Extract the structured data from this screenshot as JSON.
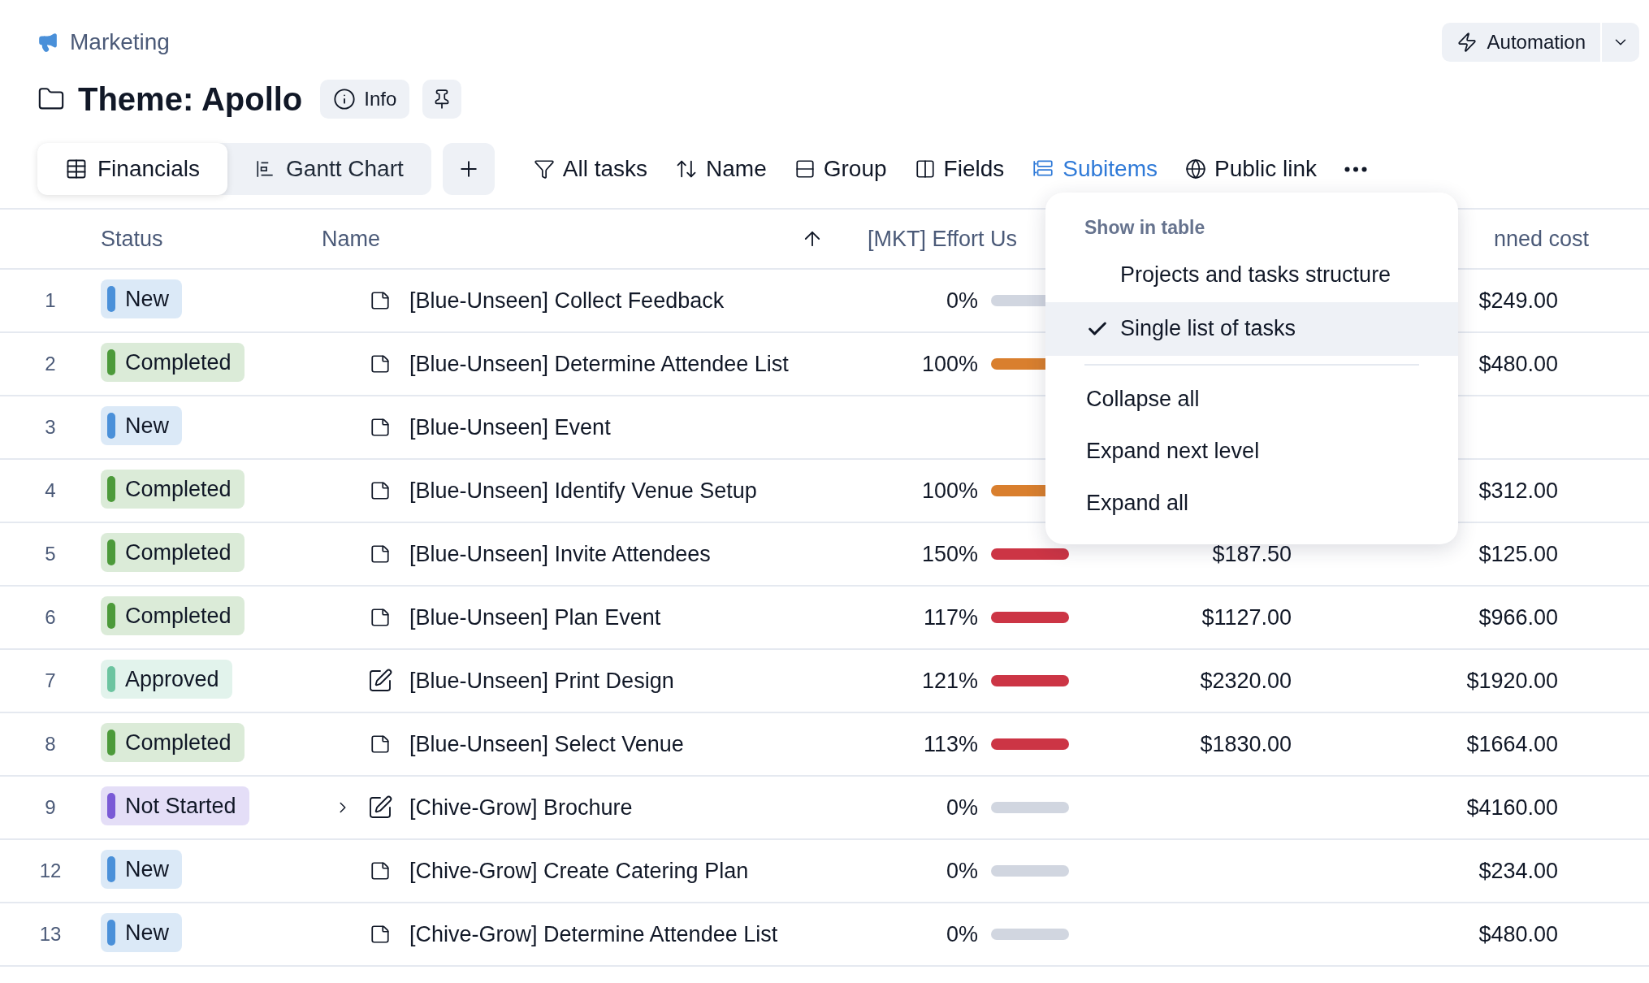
{
  "breadcrumb": "Marketing",
  "title": "Theme: Apollo",
  "info_button": "Info",
  "automation_button": "Automation",
  "views": [
    {
      "label": "Financials",
      "kind": "table",
      "selected": true
    },
    {
      "label": "Gantt Chart",
      "kind": "gantt",
      "selected": false
    }
  ],
  "toolbar": [
    {
      "label": "All tasks",
      "kind": "filter",
      "active": false
    },
    {
      "label": "Name",
      "kind": "sort",
      "active": false
    },
    {
      "label": "Group",
      "kind": "group",
      "active": false
    },
    {
      "label": "Fields",
      "kind": "fields",
      "active": false
    },
    {
      "label": "Subitems",
      "kind": "subitems",
      "active": true
    },
    {
      "label": "Public link",
      "kind": "link",
      "active": false
    }
  ],
  "table": {
    "columns": [
      "Status",
      "Name",
      "[MKT] Effort Us",
      "nned cost"
    ],
    "rows": [
      {
        "number": "1",
        "status": {
          "label": "New",
          "color": "#4a90d9"
        },
        "kind": "task",
        "name": "[Blue-Unseen] Collect Feedback",
        "effort": "0%",
        "bar": {
          "color": "#d1d6e0"
        },
        "column_4": null,
        "cost": "$249.00"
      },
      {
        "number": "2",
        "status": {
          "label": "Completed",
          "color": "#4c9a3a"
        },
        "kind": "task",
        "name": "[Blue-Unseen] Determine Attendee List",
        "effort": "100%",
        "bar": {
          "color": "#d97f2e"
        },
        "column_4": null,
        "cost": "$480.00"
      },
      {
        "number": "3",
        "status": {
          "label": "New",
          "color": "#4a90d9"
        },
        "kind": "task",
        "name": "[Blue-Unseen] Event",
        "effort": null,
        "bar": null,
        "column_4": null,
        "cost": null
      },
      {
        "number": "4",
        "status": {
          "label": "Completed",
          "color": "#4c9a3a"
        },
        "kind": "task",
        "name": "[Blue-Unseen] Identify Venue Setup",
        "effort": "100%",
        "bar": {
          "color": "#d97f2e"
        },
        "column_4": null,
        "cost": "$312.00"
      },
      {
        "number": "5",
        "status": {
          "label": "Completed",
          "color": "#4c9a3a"
        },
        "kind": "task",
        "name": "[Blue-Unseen] Invite Attendees",
        "effort": "150%",
        "bar": {
          "color": "#cc3545"
        },
        "column_4": "$187.50",
        "cost": "$125.00"
      },
      {
        "number": "6",
        "status": {
          "label": "Completed",
          "color": "#4c9a3a"
        },
        "kind": "task",
        "name": "[Blue-Unseen] Plan Event",
        "effort": "117%",
        "bar": {
          "color": "#cc3545"
        },
        "column_4": "$1127.00",
        "cost": "$966.00"
      },
      {
        "number": "7",
        "status": {
          "label": "Approved",
          "color": "#6cc4a0"
        },
        "kind": "design",
        "name": "[Blue-Unseen] Print Design",
        "effort": "121%",
        "bar": {
          "color": "#cc3545"
        },
        "column_4": "$2320.00",
        "cost": "$1920.00"
      },
      {
        "number": "8",
        "status": {
          "label": "Completed",
          "color": "#4c9a3a"
        },
        "kind": "task",
        "name": "[Blue-Unseen] Select Venue",
        "effort": "113%",
        "bar": {
          "color": "#cc3545"
        },
        "column_4": "$1830.00",
        "cost": "$1664.00"
      },
      {
        "number": "9",
        "status": {
          "label": "Not Started",
          "color": "#7a5ad6"
        },
        "kind": "design",
        "expanded": false,
        "name": "[Chive-Grow] Brochure",
        "effort": "0%",
        "bar": {
          "color": "#d1d6e0"
        },
        "column_4": null,
        "cost": "$4160.00"
      },
      {
        "number": "12",
        "status": {
          "label": "New",
          "color": "#4a90d9"
        },
        "kind": "task",
        "name": "[Chive-Grow] Create Catering Plan",
        "effort": "0%",
        "bar": {
          "color": "#d1d6e0"
        },
        "column_4": null,
        "cost": "$234.00"
      },
      {
        "number": "13",
        "status": {
          "label": "New",
          "color": "#4a90d9"
        },
        "kind": "task",
        "name": "[Chive-Grow] Determine Attendee List",
        "effort": "0%",
        "bar": {
          "color": "#d1d6e0"
        },
        "column_4": null,
        "cost": "$480.00"
      }
    ]
  },
  "subitems_menu": {
    "heading": "Show in table",
    "items": [
      {
        "kind": "option",
        "label": "Projects and tasks structure",
        "selected": false
      },
      {
        "kind": "option",
        "label": "Single list of tasks",
        "selected": true
      },
      {
        "kind": "divider"
      },
      {
        "kind": "action",
        "label": "Collapse all"
      },
      {
        "kind": "action",
        "label": "Expand next level"
      },
      {
        "kind": "action",
        "label": "Expand all"
      }
    ]
  }
}
